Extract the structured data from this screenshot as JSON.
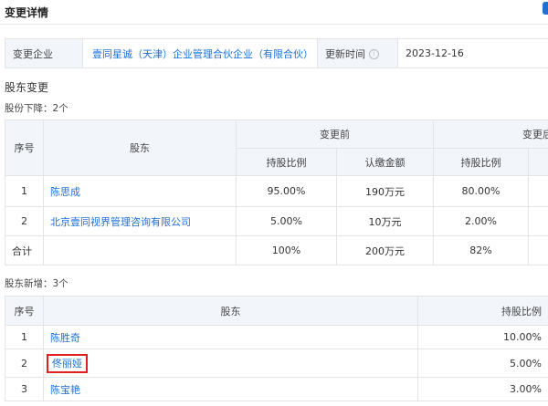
{
  "header": {
    "title": "变更详情"
  },
  "info": {
    "company_label": "变更企业",
    "company_name": "壹同星诚（天津）企业管理合伙企业（有限合伙）",
    "time_label": "更新时间",
    "time_value": "2023-12-16",
    "info_icon": "info-circle-icon"
  },
  "shareholder_change": {
    "section_title": "股东变更",
    "decrease_label": "股份下降：2个",
    "headers": {
      "index": "序号",
      "shareholder": "股东",
      "before": "变更前",
      "after": "变更后",
      "ratio": "持股比例",
      "amount": "认缴金额"
    },
    "rows": [
      {
        "index": "1",
        "name": "陈思成",
        "before_ratio": "95.00%",
        "before_amount": "190万元",
        "after_ratio": "80.00%"
      },
      {
        "index": "2",
        "name": "北京壹同视界管理咨询有限公司",
        "before_ratio": "5.00%",
        "before_amount": "10万元",
        "after_ratio": "2.00%"
      }
    ],
    "total": {
      "label": "合计",
      "before_ratio": "100%",
      "before_amount": "200万元",
      "after_ratio": "82%"
    }
  },
  "new_shareholders": {
    "label": "股东新增：3个",
    "headers": {
      "index": "序号",
      "shareholder": "股东",
      "ratio": "持股比例"
    },
    "rows": [
      {
        "index": "1",
        "name": "陈胜奇",
        "ratio": "10.00%"
      },
      {
        "index": "2",
        "name": "佟丽娅",
        "ratio": "5.00%"
      },
      {
        "index": "3",
        "name": "陈宝艳",
        "ratio": "3.00%"
      }
    ]
  },
  "colors": {
    "link": "#1e6fd9",
    "header_bg": "#f2f5fa",
    "highlight": "#e02020"
  }
}
